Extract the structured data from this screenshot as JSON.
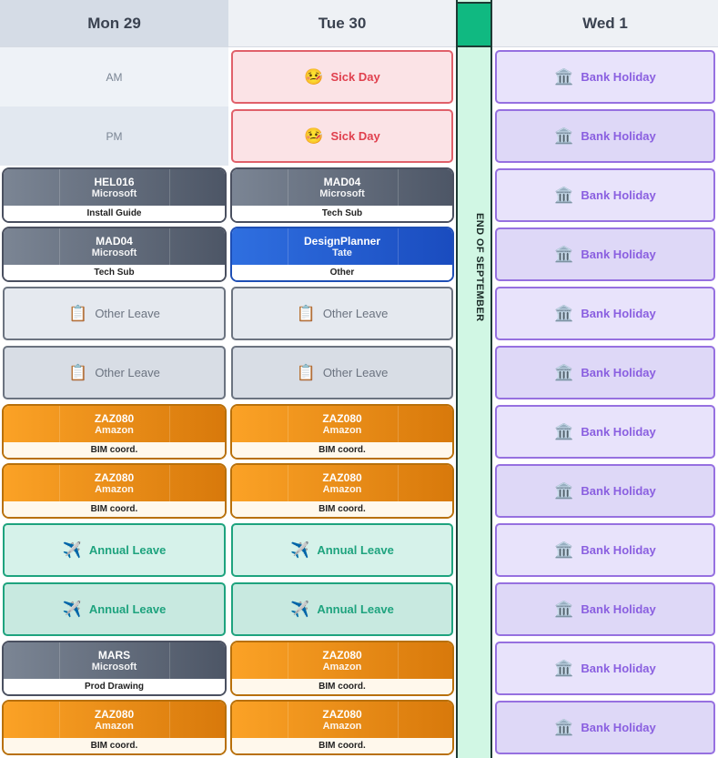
{
  "days": {
    "mon": "Mon 29",
    "tue": "Tue 30",
    "wed": "Wed 1"
  },
  "separator": {
    "label": "END OF SEPTEMBER",
    "accent": "#10b981"
  },
  "halfday": {
    "am": "AM",
    "pm": "PM"
  },
  "labels": {
    "sick": "Sick Day",
    "bank": "Bank Holiday",
    "other": "Other Leave",
    "annual": "Annual Leave"
  },
  "icons": {
    "sick": "sick-face-icon",
    "bank": "bank-building-icon",
    "other": "clipboard-icon",
    "annual": "airplane-icon"
  },
  "projects": {
    "hel016": {
      "code": "HEL016",
      "client": "Microsoft",
      "task": "Install Guide"
    },
    "mad04_tue": {
      "code": "MAD04",
      "client": "Microsoft",
      "task": "Tech Sub"
    },
    "mad04_mon": {
      "code": "MAD04",
      "client": "Microsoft",
      "task": "Tech Sub"
    },
    "designplanner": {
      "code": "DesignPlanner",
      "client": "Tate",
      "task": "Other"
    },
    "zaz080_r7_mon": {
      "code": "ZAZ080",
      "client": "Amazon",
      "task": "BIM coord."
    },
    "zaz080_r7_tue": {
      "code": "ZAZ080",
      "client": "Amazon",
      "task": "BIM coord."
    },
    "zaz080_r8_mon": {
      "code": "ZAZ080",
      "client": "Amazon",
      "task": "BIM coord."
    },
    "zaz080_r8_tue": {
      "code": "ZAZ080",
      "client": "Amazon",
      "task": "BIM coord."
    },
    "mars": {
      "code": "MARS",
      "client": "Microsoft",
      "task": "Prod Drawing"
    },
    "zaz080_r11_tue": {
      "code": "ZAZ080",
      "client": "Amazon",
      "task": "BIM coord."
    },
    "zaz080_r12_mon": {
      "code": "ZAZ080",
      "client": "Amazon",
      "task": "BIM coord."
    },
    "zaz080_r12_tue": {
      "code": "ZAZ080",
      "client": "Amazon",
      "task": "BIM coord."
    }
  }
}
